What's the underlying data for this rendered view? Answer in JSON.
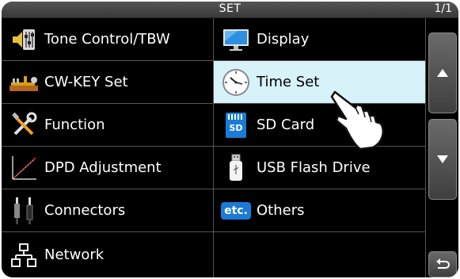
{
  "header": {
    "title": "SET",
    "page_indicator": "1/1"
  },
  "menu": {
    "tone_control": "Tone Control/TBW",
    "display": "Display",
    "cw_key_set": "CW-KEY Set",
    "time_set": "Time Set",
    "function": "Function",
    "sd_card": "SD Card",
    "sd_badge": "SD",
    "dpd_adjustment": "DPD Adjustment",
    "usb_flash_drive": "USB Flash Drive",
    "connectors": "Connectors",
    "others": "Others",
    "etc_badge": "etc.",
    "network": "Network"
  },
  "selected_item": "Time Set",
  "colors": {
    "selected_bg": "#d7f2f8",
    "accent_blue": "#1a7bd6"
  }
}
